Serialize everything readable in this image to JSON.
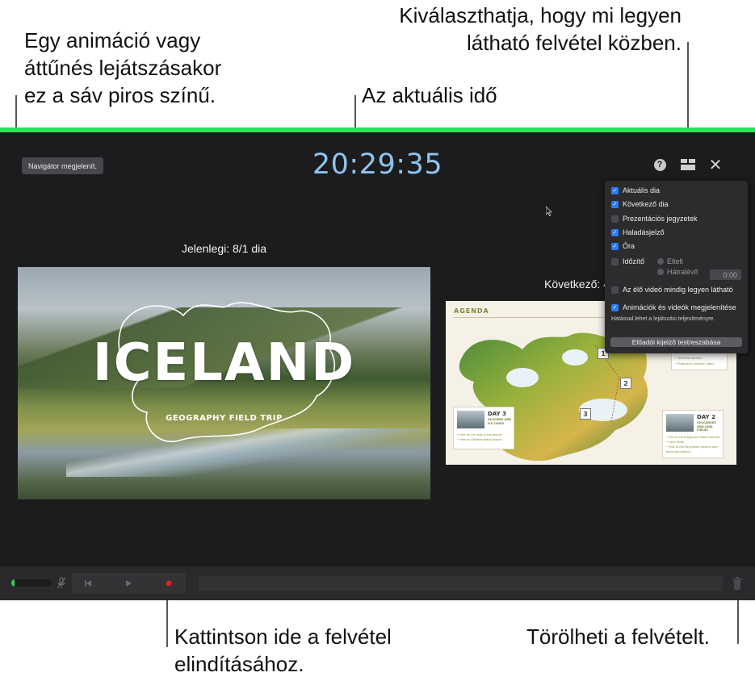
{
  "callouts": {
    "animation_bar": [
      "Egy animáció vagy",
      "áttűnés lejátszásakor",
      "ez a sáv piros színű."
    ],
    "choose_visible": [
      "Kiválaszthatja, hogy mi legyen",
      "látható felvétel közben."
    ],
    "current_time": "Az aktuális idő",
    "start_recording": [
      "Kattintson ide a felvétel",
      "elindításához."
    ],
    "delete_recording": "Törölheti a felvételt."
  },
  "screen": {
    "navigator_button": "Navigátor megjelenít.",
    "clock": "20:29:35",
    "current_label": "Jelenlegi: 8/1 dia",
    "next_label": "Következő: 4",
    "close_glyph": "✕",
    "help_glyph": "?"
  },
  "current_slide": {
    "title": "ICELAND",
    "subtitle": "GEOGRAPHY FIELD TRIP"
  },
  "next_slide": {
    "title": "AGENDA",
    "badges": [
      "1",
      "2",
      "3"
    ],
    "day3": {
      "day": "DAY 3",
      "sub": [
        "GLACIERS AND",
        "ICE CAVES"
      ],
      "bullets": [
        "• Visit an ice cave in the glacier",
        "• Hike on Sólheimajökull glacier"
      ]
    },
    "day2": {
      "day": "DAY 2",
      "sub": [
        "VOLCANOES",
        "AND LAVA FIELDS"
      ],
      "bullets": [
        "• Trip to the Eldgjá and Hekla volcano",
        "• Lava fields",
        "• Visit to the Reykjanes volcano and",
        "  black sand beach"
      ]
    },
    "day1": {
      "bullets": [
        "• Explore the ice caves",
        "• Travel to Akureyri",
        "• Viewing of northern lights"
      ]
    }
  },
  "menu": {
    "items": [
      {
        "label": "Aktuális dia",
        "checked": true
      },
      {
        "label": "Következő dia",
        "checked": true
      },
      {
        "label": "Prezentációs jegyzetek",
        "checked": false
      },
      {
        "label": "Haladásjelző",
        "checked": true
      },
      {
        "label": "Óra",
        "checked": true
      },
      {
        "label": "Időzítő",
        "checked": false
      }
    ],
    "timer_options": [
      "Eltelt",
      "Hátralévő"
    ],
    "timer_value": "0:00",
    "live_video": {
      "label": "Az élő videó mindig legyen látható",
      "checked": false
    },
    "animations": {
      "label": "Animációk és videók megjelenítése",
      "checked": true
    },
    "note": "Hatással lehet a lejátszási teljesítményre.",
    "customize_button": "Előadói kijelző testreszabása"
  },
  "toolbar": {
    "mic_level": 0.08
  },
  "colors": {
    "progress_bar": "#2fe255",
    "clock": "#8fc3ef",
    "record_button": "#e02020",
    "checkbox_on": "#2a7cf6"
  }
}
